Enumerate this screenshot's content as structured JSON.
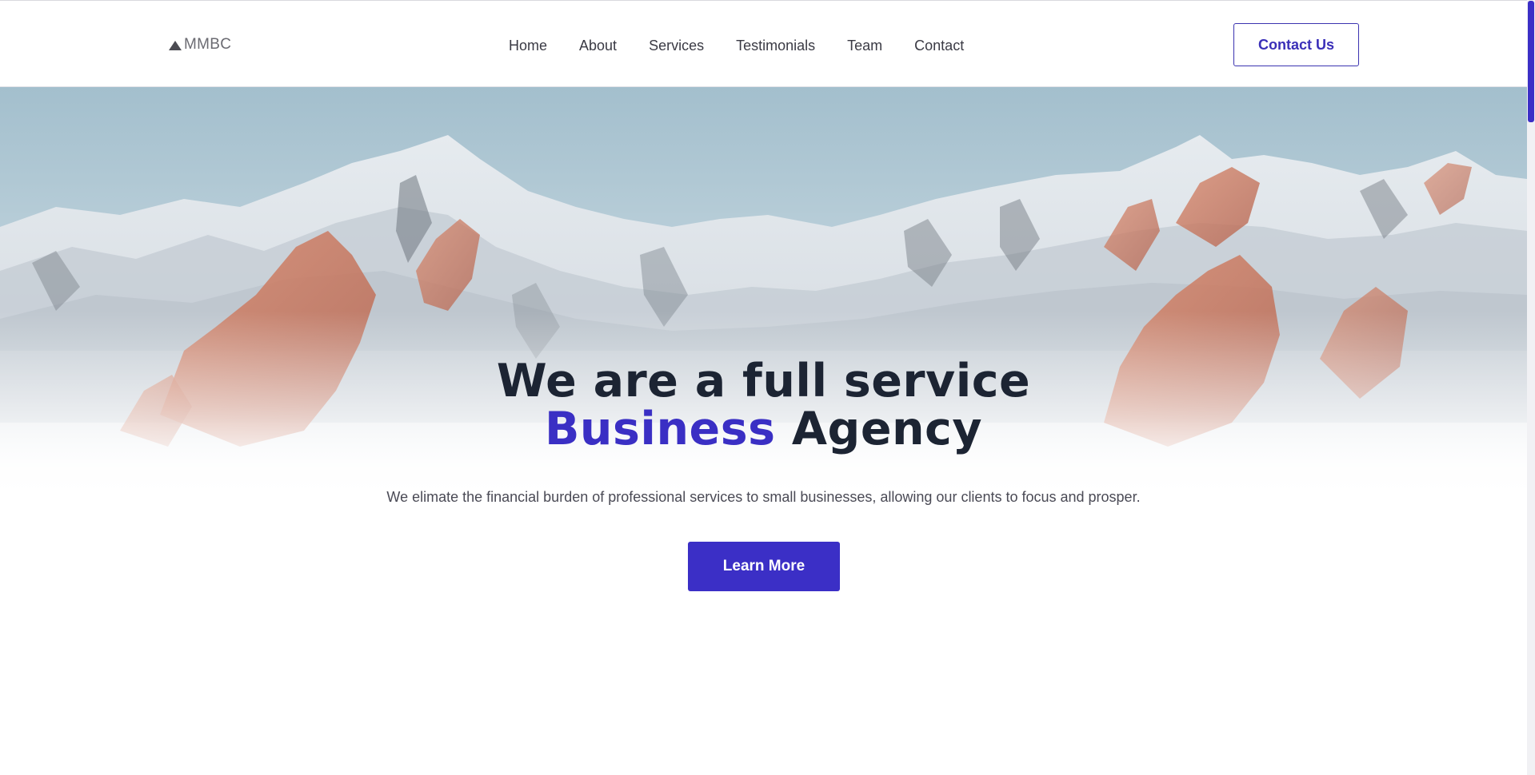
{
  "brand": {
    "logo_text": "MMBC",
    "logo_icon": "mountain-triangle-icon"
  },
  "nav": {
    "items": [
      {
        "label": "Home"
      },
      {
        "label": "About"
      },
      {
        "label": "Services"
      },
      {
        "label": "Testimonials"
      },
      {
        "label": "Team"
      },
      {
        "label": "Contact"
      }
    ]
  },
  "header": {
    "cta_label": "Contact Us"
  },
  "hero": {
    "title_line1": "We are a full service",
    "title_accent": "Business",
    "title_end": " Agency",
    "subtitle": "We elimate the financial burden of professional services to small businesses, allowing our clients to focus and prosper.",
    "button_label": "Learn More",
    "background_image": "snowy-mountains-photo"
  },
  "colors": {
    "accent": "#3b2fc6",
    "heading": "#1c2433",
    "text": "#4a4a55"
  }
}
